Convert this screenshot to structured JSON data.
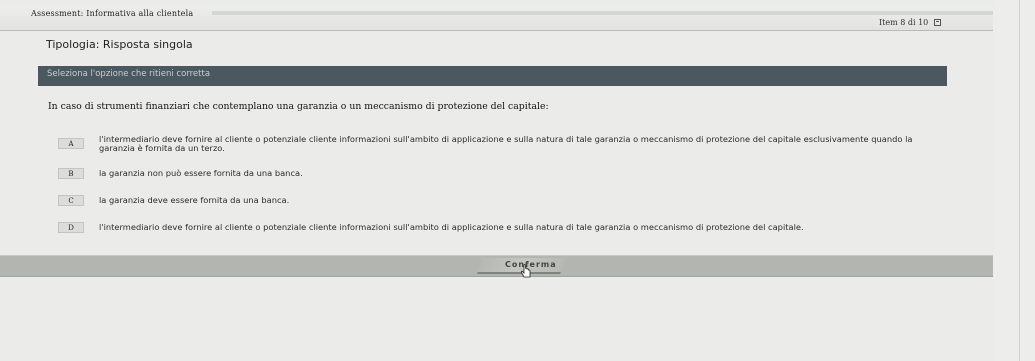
{
  "header": {
    "assessment_title": "Assessment: Informativa alla clientela",
    "item_counter": "Item 8 di 10"
  },
  "question_type": "Tipologia: Risposta singola",
  "instruction": "Seleziona l'opzione che ritieni corretta",
  "question": "In caso di strumenti finanziari che contemplano una garanzia o un meccanismo di protezione del capitale:",
  "options": [
    {
      "letter": "A",
      "text": "l'intermediario deve fornire al cliente o potenziale cliente informazioni sull'ambito di applicazione e sulla natura di tale garanzia o meccanismo di protezione del capitale esclusivamente quando la garanzia è fornita da un terzo."
    },
    {
      "letter": "B",
      "text": "la garanzia non può essere fornita da una banca."
    },
    {
      "letter": "C",
      "text": "la garanzia deve essere fornita da una banca."
    },
    {
      "letter": "D",
      "text": "l'intermediario deve fornire al cliente o potenziale cliente informazioni sull'ambito di applicazione e sulla natura di tale garanzia o meccanismo di protezione del capitale."
    }
  ],
  "confirm_label": "Conferma",
  "icons": {
    "flag": "flag-icon",
    "cursor": "hand-cursor-icon"
  }
}
